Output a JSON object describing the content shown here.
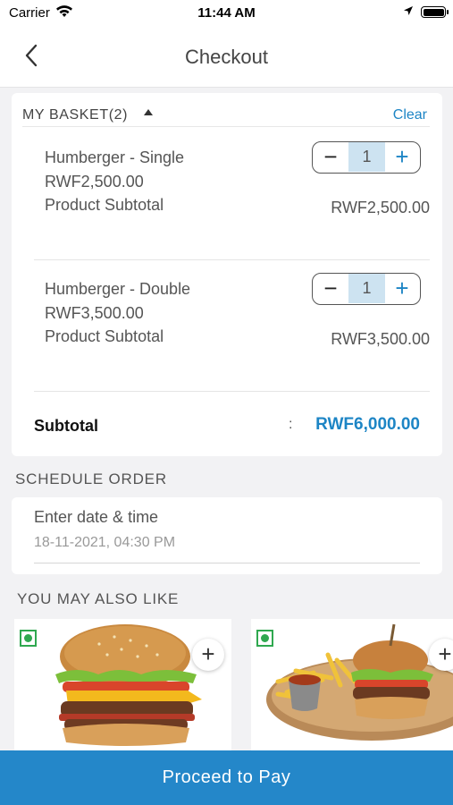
{
  "status_bar": {
    "carrier": "Carrier",
    "time": "11:44 AM"
  },
  "nav": {
    "title": "Checkout"
  },
  "basket": {
    "title": "MY BASKET(2)",
    "clear_label": "Clear",
    "items": [
      {
        "name": "Humberger - Single",
        "price": "RWF2,500.00",
        "subtotal_label": "Product Subtotal",
        "subtotal_value": "RWF2,500.00",
        "quantity": "1",
        "minus": "−",
        "plus": "+"
      },
      {
        "name": "Humberger - Double",
        "price": "RWF3,500.00",
        "subtotal_label": "Product Subtotal",
        "subtotal_value": "RWF3,500.00",
        "quantity": "1",
        "minus": "−",
        "plus": "+"
      }
    ],
    "subtotal_label": "Subtotal",
    "subtotal_colon": ":",
    "subtotal_value": "RWF6,000.00"
  },
  "schedule": {
    "section_title": "SCHEDULE ORDER",
    "label": "Enter date & time",
    "value": "18-11-2021, 04:30 PM"
  },
  "recommendations": {
    "section_title": "YOU MAY ALSO LIKE",
    "add_label": "+"
  },
  "footer": {
    "proceed_label": "Proceed to Pay"
  },
  "colors": {
    "accent": "#1d85c5",
    "button": "#2487c9",
    "veg": "#2fa84f"
  }
}
